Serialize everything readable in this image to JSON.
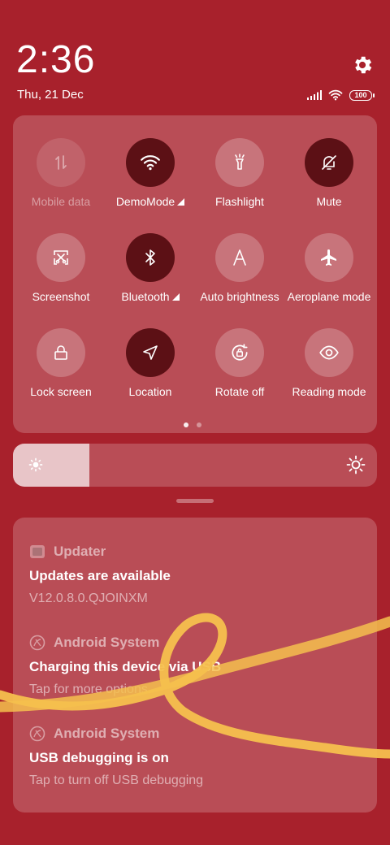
{
  "status_bar": {
    "time": "2:36",
    "date": "Thu, 21 Dec",
    "battery": "100"
  },
  "quick_settings": {
    "tiles": [
      {
        "label": "Mobile data",
        "icon": "mobile-data-icon",
        "state": "disabled"
      },
      {
        "label": "DemoMode",
        "icon": "wifi-icon",
        "state": "active"
      },
      {
        "label": "Flashlight",
        "icon": "flashlight-icon",
        "state": "inactive"
      },
      {
        "label": "Mute",
        "icon": "mute-bell-icon",
        "state": "active"
      },
      {
        "label": "Screenshot",
        "icon": "screenshot-icon",
        "state": "inactive"
      },
      {
        "label": "Bluetooth",
        "icon": "bluetooth-icon",
        "state": "active"
      },
      {
        "label": "Auto brightness",
        "icon": "auto-brightness-icon",
        "state": "inactive"
      },
      {
        "label": "Aeroplane mode",
        "icon": "aeroplane-icon",
        "state": "inactive"
      },
      {
        "label": "Lock screen",
        "icon": "lock-icon",
        "state": "inactive"
      },
      {
        "label": "Location",
        "icon": "location-icon",
        "state": "active"
      },
      {
        "label": "Rotate off",
        "icon": "rotate-lock-icon",
        "state": "inactive"
      },
      {
        "label": "Reading mode",
        "icon": "eye-icon",
        "state": "inactive"
      }
    ],
    "page_count": 2,
    "current_page": 1
  },
  "brightness": {
    "level": 0.21
  },
  "notifications": [
    {
      "app": "Updater",
      "title": "Updates are available",
      "body": "V12.0.8.0.QJOINXM"
    },
    {
      "app": "Android System",
      "title": "Charging this device via USB",
      "body": "Tap for more options."
    },
    {
      "app": "Android System",
      "title": "USB debugging is on",
      "body": "Tap to turn off USB debugging"
    }
  ],
  "colors": {
    "background": "#a8212c",
    "active_tile": "#5c1015",
    "ribbon": "#f5c04e"
  }
}
